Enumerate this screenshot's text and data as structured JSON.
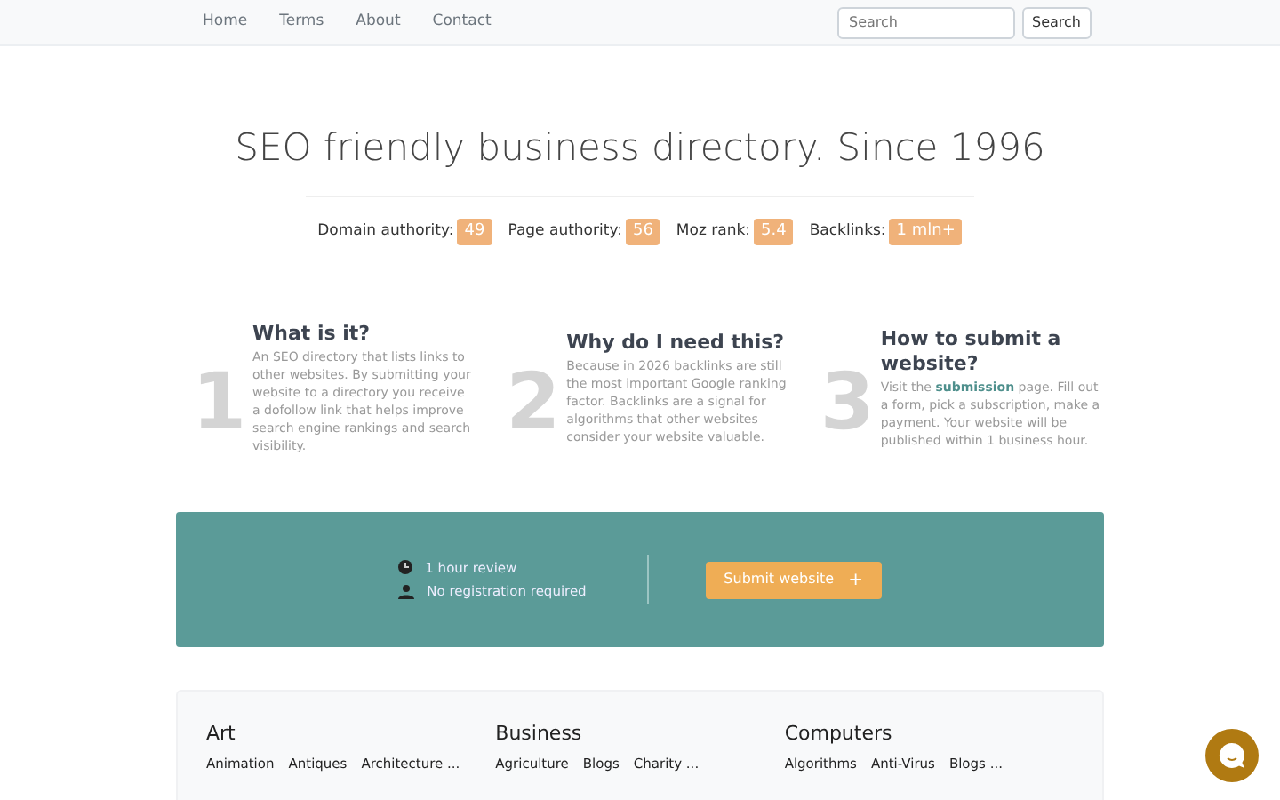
{
  "nav": {
    "links": [
      "Home",
      "Terms",
      "About",
      "Contact"
    ],
    "search": {
      "placeholder": "Search",
      "button": "Search"
    }
  },
  "hero": {
    "title": "SEO friendly business directory. Since 1996",
    "stats": [
      {
        "label": "Domain authority:",
        "value": "49"
      },
      {
        "label": "Page authority:",
        "value": "56"
      },
      {
        "label": "Moz rank:",
        "value": "5.4"
      },
      {
        "label": "Backlinks:",
        "value": "1 mln+"
      }
    ]
  },
  "features": [
    {
      "number": "1",
      "title": "What is it?",
      "text": "An SEO directory that lists links to other websites. By submitting your website to a directory you receive a dofollow link that helps improve search engine rankings and search visibility."
    },
    {
      "number": "2",
      "title": "Why do I need this?",
      "text": "Because in 2026 backlinks are still the most important Google ranking factor. Backlinks are a signal for algorithms that other websites consider your website valuable."
    },
    {
      "number": "3",
      "title": "How to submit a website?",
      "text": "Visit the **submission** page. Fill out a form, pick a subscription, make a payment. Your website will be published within 1 business hour."
    }
  ],
  "banner": {
    "points": [
      {
        "kind": "clock",
        "text": "1 hour review"
      },
      {
        "kind": "person",
        "text": "No registration required"
      }
    ],
    "button": "Submit website",
    "button_icon": "+"
  },
  "categories": [
    {
      "name": "Art",
      "subs": [
        "Animation",
        "Antiques",
        "Architecture ..."
      ]
    },
    {
      "name": "Business",
      "subs": [
        "Agriculture",
        "Blogs",
        "Charity ..."
      ]
    },
    {
      "name": "Computers",
      "subs": [
        "Algorithms",
        "Anti-Virus",
        "Blogs ..."
      ]
    }
  ]
}
